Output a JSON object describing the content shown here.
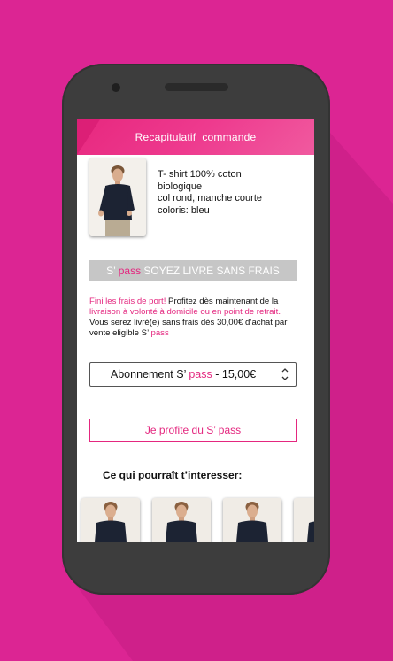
{
  "colors": {
    "background": "#dc2593",
    "accent": "#e4277f",
    "phone_body": "#3d3d3d",
    "banner_grey": "#c6c6c6"
  },
  "header": {
    "title": "Recapitulatif  commande"
  },
  "product": {
    "image_icon": "tshirt-model-photo",
    "lines": [
      "T- shirt 100% coton",
      "biologique",
      "col rond, manche courte",
      "coloris: bleu"
    ]
  },
  "pass_banner": {
    "prefix": "S’ ",
    "pass": "pass",
    "suffix": " SOYEZ LIVRE SANS FRAIS"
  },
  "promo": {
    "line1_pink": "Fini les frais de port!",
    "line1_rest": " Profitez dès maintenant de la",
    "line2_pink": "livraison à volonté à domicile ou en point de retrait.",
    "line3": "Vous serez livré(e) sans frais dès 30,00€ d’achat par",
    "line4_prefix": "vente eligible S’ ",
    "line4_pink": "pass"
  },
  "subscription_select": {
    "prefix": "Abonnement S’ ",
    "pass": "pass",
    "suffix": " - 15,00€",
    "icon": "up-down-chevron-icon"
  },
  "profit_button": {
    "label": "Je profite du S’ pass"
  },
  "recommendations": {
    "title": "Ce qui pourraît t’interesser:",
    "items": [
      "model-photo",
      "model-photo",
      "model-photo",
      "model-photo"
    ]
  }
}
